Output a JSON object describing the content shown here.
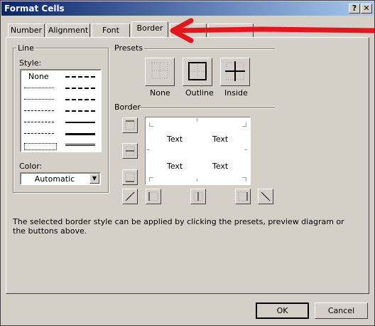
{
  "window": {
    "title": "Format Cells",
    "help_label": "?",
    "close_label": "X"
  },
  "tabs": [
    {
      "label": "Number"
    },
    {
      "label": "Alignment"
    },
    {
      "label": "Font"
    },
    {
      "label": "Border",
      "active": true
    },
    {
      "label": ""
    },
    {
      "label": ""
    }
  ],
  "line": {
    "group_label": "Line",
    "style_label": "Style:",
    "none_label": "None",
    "color_label": "Color:",
    "color_value": "Automatic"
  },
  "presets": {
    "group_label": "Presets",
    "items": [
      {
        "label": "None"
      },
      {
        "label": "Outline"
      },
      {
        "label": "Inside"
      }
    ]
  },
  "border": {
    "group_label": "Border",
    "preview_texts": [
      "Text",
      "Text",
      "Text",
      "Text"
    ]
  },
  "hint": "The selected border style can be applied by clicking the presets, preview diagram or the buttons above.",
  "buttons": {
    "ok": "OK",
    "cancel": "Cancel"
  },
  "annotation": {
    "arrow_color": "#e8141c"
  },
  "colors": {
    "dialog_bg": "#d4d0c8",
    "title_start": "#0a246a",
    "title_end": "#a6caf0"
  }
}
